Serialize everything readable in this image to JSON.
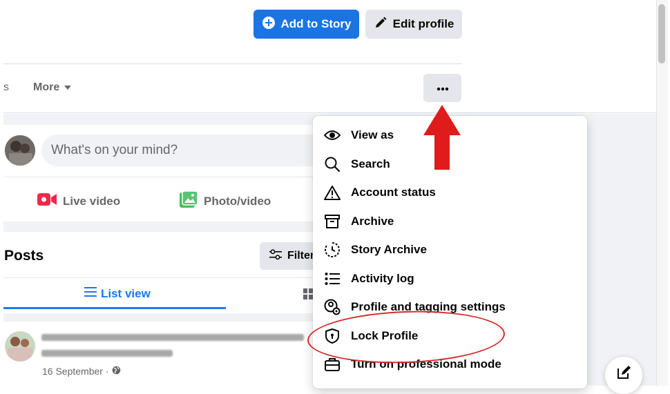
{
  "profile_header": {
    "add_story_label": "Add to Story",
    "edit_profile_label": "Edit profile"
  },
  "tabs": {
    "cut_tab_label": "s",
    "more_label": "More"
  },
  "composer": {
    "placeholder": "What's on your mind?",
    "live_video_label": "Live video",
    "photo_video_label": "Photo/video"
  },
  "posts": {
    "title": "Posts",
    "filter_label": "Filter",
    "list_view_label": "List view",
    "post_date": "16 September ·"
  },
  "menu": {
    "items": [
      {
        "label": "View as",
        "icon": "eye-icon"
      },
      {
        "label": "Search",
        "icon": "search-icon"
      },
      {
        "label": "Account status",
        "icon": "warning-icon"
      },
      {
        "label": "Archive",
        "icon": "archive-icon"
      },
      {
        "label": "Story Archive",
        "icon": "story-archive-icon"
      },
      {
        "label": "Activity log",
        "icon": "list-icon"
      },
      {
        "label": "Profile and tagging settings",
        "icon": "profile-settings-icon"
      },
      {
        "label": "Lock Profile",
        "icon": "shield-lock-icon"
      },
      {
        "label": "Turn on professional mode",
        "icon": "briefcase-icon"
      }
    ]
  },
  "colors": {
    "primary_blue": "#1b74e4",
    "link_blue": "#1877f2",
    "annotation_red": "#e01b1b",
    "secondary_gray": "#e4e6eb",
    "page_gray": "#f0f2f5"
  }
}
